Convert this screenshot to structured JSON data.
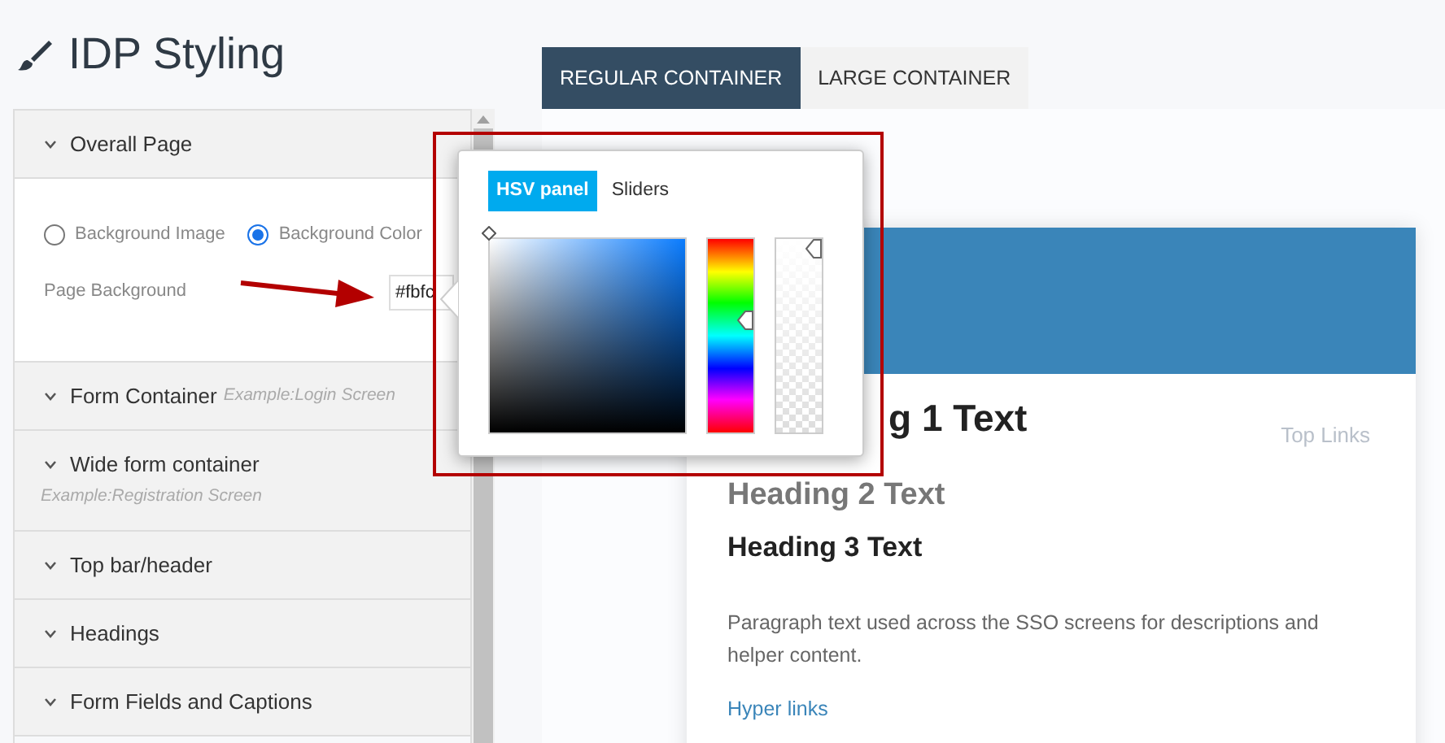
{
  "title": "IDP Styling",
  "sections": [
    {
      "title": "Overall Page",
      "options": [
        {
          "label": "Background Image",
          "selected": false
        },
        {
          "label": "Background Color",
          "selected": true
        }
      ],
      "field": {
        "label": "Page Background",
        "value": "#fbfc"
      }
    },
    {
      "title": "Form Container",
      "hint": "Example:Login Screen",
      "hint_below": false
    },
    {
      "title": "Wide form container",
      "hint": "Example:Registration Screen",
      "hint_below": true
    },
    {
      "title": "Top bar/header"
    },
    {
      "title": "Headings"
    },
    {
      "title": "Form Fields and Captions"
    }
  ],
  "preview_tabs": [
    {
      "label": "REGULAR CONTAINER",
      "selected": true
    },
    {
      "label": "LARGE CONTAINER",
      "selected": false
    }
  ],
  "preview": {
    "top_links": "Top Links",
    "heading_1": "g 1 Text",
    "heading_2": "Heading 2 Text",
    "heading_3": "Heading 3 Text",
    "paragraph": "Paragraph text used across the SSO screens for descriptions and helper content.",
    "link": "Hyper links"
  },
  "color_picker": {
    "tabs": [
      {
        "label": "HSV panel",
        "selected": true
      },
      {
        "label": "Sliders",
        "selected": false
      }
    ],
    "hue": {
      "level": 0.59
    },
    "alpha": {
      "level": 1
    }
  }
}
